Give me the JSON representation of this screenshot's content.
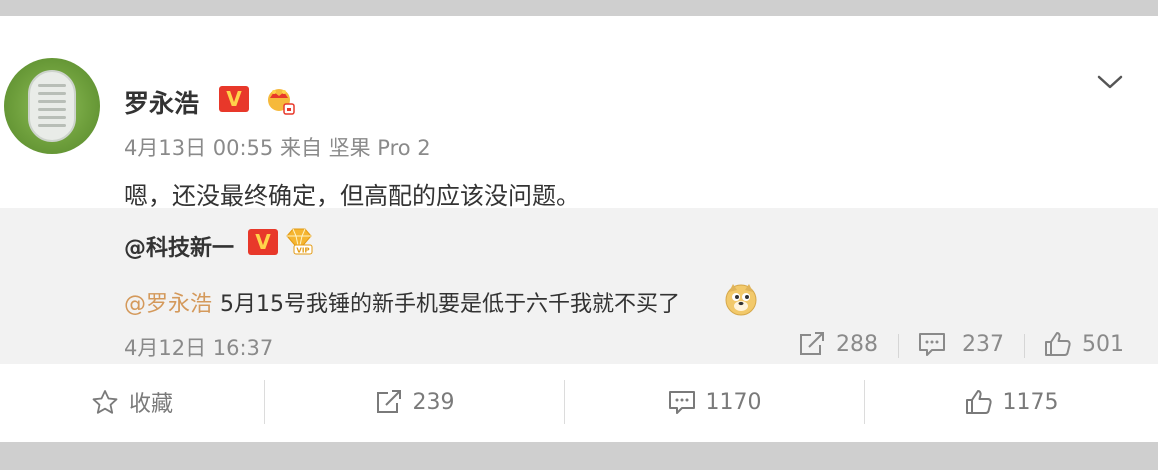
{
  "post": {
    "author": "罗永浩",
    "verified_label": "V",
    "meta": "4月13日 00:55 来自 坚果 Pro 2",
    "content": "嗯，还没最终确定，但高配的应该没问题。"
  },
  "repost": {
    "user": "@科技新一",
    "verified_label": "V",
    "mention": "@罗永浩",
    "text": "5月15号我锤的新手机要是低于六千我就不买了",
    "date": "4月12日 16:37",
    "shares": "288",
    "comments": "237",
    "likes": "501"
  },
  "actions": {
    "favorite": "收藏",
    "share": "239",
    "comment": "1170",
    "like": "1175"
  },
  "colors": {
    "mention": "#d4995b",
    "verified_bg": "#e8382a",
    "verified_fg": "#ffd34a"
  }
}
